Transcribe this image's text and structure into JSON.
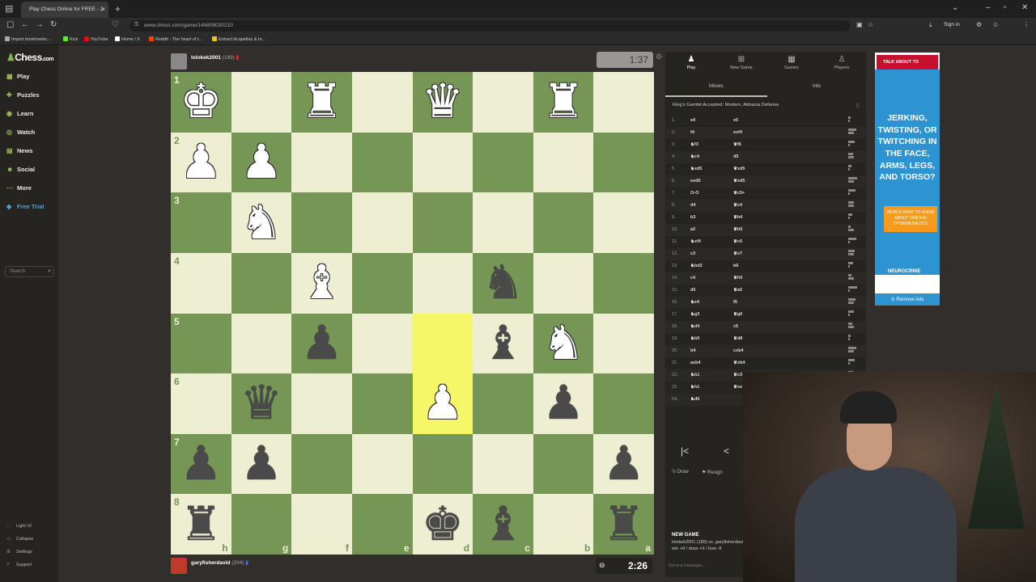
{
  "browser": {
    "tab_title": "Play Chess Online for FREE - 2",
    "tab_close": "×",
    "new_tab": "+",
    "url": "www.chess.com/game/146808030210",
    "sign_in": "Sign in",
    "bookmarks": [
      {
        "label": "Import bookmarks...",
        "color": "#aaaaaa"
      },
      {
        "label": "Kick",
        "color": "#53fc18"
      },
      {
        "label": "YouTube",
        "color": "#ff0000"
      },
      {
        "label": "Home / X",
        "color": "#ffffff"
      },
      {
        "label": "Reddit - The heart of t...",
        "color": "#ff4500"
      },
      {
        "label": "Extract Acapellas & In...",
        "color": "#f5c518"
      }
    ]
  },
  "sidebar": {
    "logo_main": "Chess",
    "logo_suffix": ".com",
    "items": [
      {
        "label": "Play",
        "icon": "play-board-icon"
      },
      {
        "label": "Puzzles",
        "icon": "puzzle-icon"
      },
      {
        "label": "Learn",
        "icon": "learn-icon"
      },
      {
        "label": "Watch",
        "icon": "watch-icon"
      },
      {
        "label": "News",
        "icon": "news-icon"
      },
      {
        "label": "Social",
        "icon": "social-icon"
      },
      {
        "label": "More",
        "icon": "more-icon"
      },
      {
        "label": "Free Trial",
        "icon": "diamond-icon"
      }
    ],
    "search_placeholder": "Search",
    "footer": [
      {
        "label": "Light UI",
        "icon": "lightbulb-icon"
      },
      {
        "label": "Collapse",
        "icon": "collapse-icon"
      },
      {
        "label": "Settings",
        "icon": "gear-icon"
      },
      {
        "label": "Support",
        "icon": "help-icon"
      }
    ]
  },
  "game": {
    "top_player": {
      "name": "lolokek2001",
      "rating": "(189)",
      "clock": "1:37"
    },
    "bottom_player": {
      "name": "garyfisherdavid",
      "rating": "(204)",
      "clock": "2:26"
    },
    "files_bottom": [
      "h",
      "g",
      "f",
      "e",
      "d",
      "c",
      "b",
      "a"
    ],
    "ranks_left": [
      "1",
      "2",
      "3",
      "4",
      "5",
      "6",
      "7",
      "8"
    ],
    "board": [
      [
        "wK",
        "",
        "wR",
        "",
        "wQ",
        "",
        "wR",
        ""
      ],
      [
        "wP",
        "wP",
        "",
        "",
        "",
        "",
        "",
        ""
      ],
      [
        "",
        "wN",
        "",
        "",
        "",
        "",
        "",
        ""
      ],
      [
        "",
        "",
        "wB",
        "",
        "",
        "bN",
        "",
        ""
      ],
      [
        "",
        "",
        "bP",
        "",
        "",
        "bB",
        "wN",
        ""
      ],
      [
        "",
        "bQ",
        "",
        "",
        "wP",
        "",
        "bP",
        ""
      ],
      [
        "bP",
        "bP",
        "",
        "",
        "",
        "",
        "",
        "bP"
      ],
      [
        "bR",
        "",
        "",
        "",
        "bK",
        "bB",
        "",
        "bR"
      ]
    ],
    "highlight": [
      [
        4,
        4
      ],
      [
        5,
        4
      ]
    ]
  },
  "panel": {
    "tabs": [
      {
        "label": "Play",
        "icon": "play-icon"
      },
      {
        "label": "New Game",
        "icon": "plus-square-icon"
      },
      {
        "label": "Games",
        "icon": "games-icon"
      },
      {
        "label": "Players",
        "icon": "players-icon"
      }
    ],
    "subtabs": {
      "moves": "Moves",
      "info": "Info"
    },
    "opening": "King's Gambit Accepted: Modern, Abbazia Defense",
    "moves": [
      [
        "1.",
        "e4",
        "e5"
      ],
      [
        "2.",
        "f4",
        "exf4"
      ],
      [
        "3.",
        "♞f3",
        "♛f6"
      ],
      [
        "4.",
        "♞c4",
        "d5"
      ],
      [
        "5.",
        "♞xd5",
        "♛xd5"
      ],
      [
        "6.",
        "exd5",
        "♛xd5"
      ],
      [
        "7.",
        "O-O",
        "♛c5+"
      ],
      [
        "8.",
        "d4",
        "♛c4"
      ],
      [
        "9.",
        "b3",
        "♛b4"
      ],
      [
        "10.",
        "a3",
        "♛b5"
      ],
      [
        "11.",
        "♞xf4",
        "♛c6"
      ],
      [
        "12.",
        "c3",
        "♛e7"
      ],
      [
        "13.",
        "♞bd2",
        "b6"
      ],
      [
        "14.",
        "c4",
        "♛h5"
      ],
      [
        "15.",
        "d5",
        "♛a5"
      ],
      [
        "16.",
        "♞e4",
        "f5"
      ],
      [
        "17.",
        "♞g3",
        "♛g6"
      ],
      [
        "18.",
        "♞d4",
        "c5"
      ],
      [
        "19.",
        "♞b5",
        "♛d8"
      ],
      [
        "20.",
        "b4",
        "cxb4"
      ],
      [
        "21.",
        "axb4",
        "♛xb4"
      ],
      [
        "22.",
        "♞b1",
        "♛c3"
      ],
      [
        "23.",
        "♞h1",
        "♛xe"
      ],
      [
        "24.",
        "♞d6",
        ""
      ]
    ],
    "nav_first": "|<",
    "nav_prev": "<",
    "draw": "Draw",
    "resign": "Resign",
    "new_game_title": "NEW GAME",
    "game_line1": "lolokek2001 (189) vs. garyfisherdavid (204)",
    "game_line2": "win +8 / draw +0 / lose -8",
    "chat_placeholder": "Send a message..."
  },
  "ad": {
    "header": "TALK ABOUT TD",
    "headline": "JERKING, TWISTING, OR TWITCHING IN THE FACE, ARMS, LEGS, AND TORSO?",
    "cta": "HERE'S WHAT TO KNOW ABOUT TARDIVE DYSKINESIA (TD)",
    "brand": "NEUROCRINE",
    "remove": "Remove Ads"
  }
}
